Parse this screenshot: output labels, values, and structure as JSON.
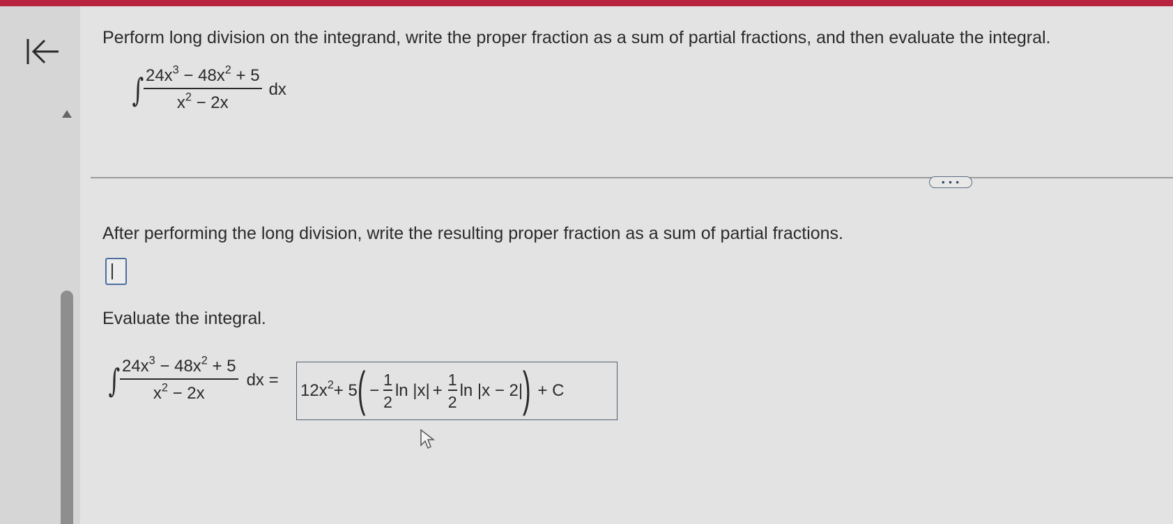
{
  "prompt": "Perform long division on the integrand, write the proper fraction as a sum of partial fractions, and then evaluate the integral.",
  "integral": {
    "sign": "∫",
    "numerator_a": "24x",
    "numerator_exp1": "3",
    "numerator_b": " − 48x",
    "numerator_exp2": "2",
    "numerator_c": " + 5",
    "denominator_a": "x",
    "denominator_exp": "2",
    "denominator_b": " − 2x",
    "differential": "dx"
  },
  "more_button": "• • •",
  "question2": "After performing the long division, write the resulting proper fraction as a sum of partial fractions.",
  "question3": "Evaluate the integral.",
  "equals": "dx =",
  "answer": {
    "term1": "12x",
    "term1_exp": "2",
    "plus5": " + 5",
    "open_paren": "(",
    "minus": "−",
    "frac_num": "1",
    "frac_den": "2",
    "ln_x": "ln |x|",
    "plus": "+",
    "frac2_num": "1",
    "frac2_den": "2",
    "ln_x2": "ln |x − 2|",
    "close_paren": ")",
    "constant": "+ C"
  }
}
